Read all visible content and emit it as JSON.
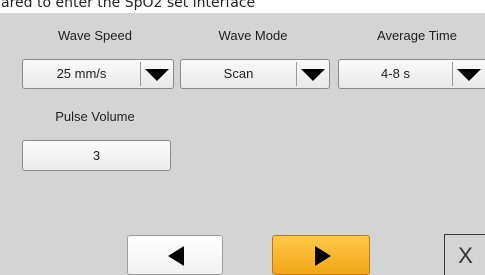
{
  "context": {
    "cropped_heading": "ared to enter the SpO2 set interface"
  },
  "settings": {
    "wave_speed": {
      "label": "Wave Speed",
      "value": "25 mm/s"
    },
    "wave_mode": {
      "label": "Wave Mode",
      "value": "Scan"
    },
    "average_time": {
      "label": "Average Time",
      "value": "4-8 s"
    },
    "pulse_volume": {
      "label": "Pulse Volume",
      "value": "3"
    }
  },
  "navigation": {
    "previous_icon": "triangle-left",
    "next_icon": "triangle-right"
  },
  "close": {
    "label": "X"
  },
  "colors": {
    "panel": "#d4d4d4",
    "next_button": "#f3a617",
    "arrow": "#000000"
  }
}
